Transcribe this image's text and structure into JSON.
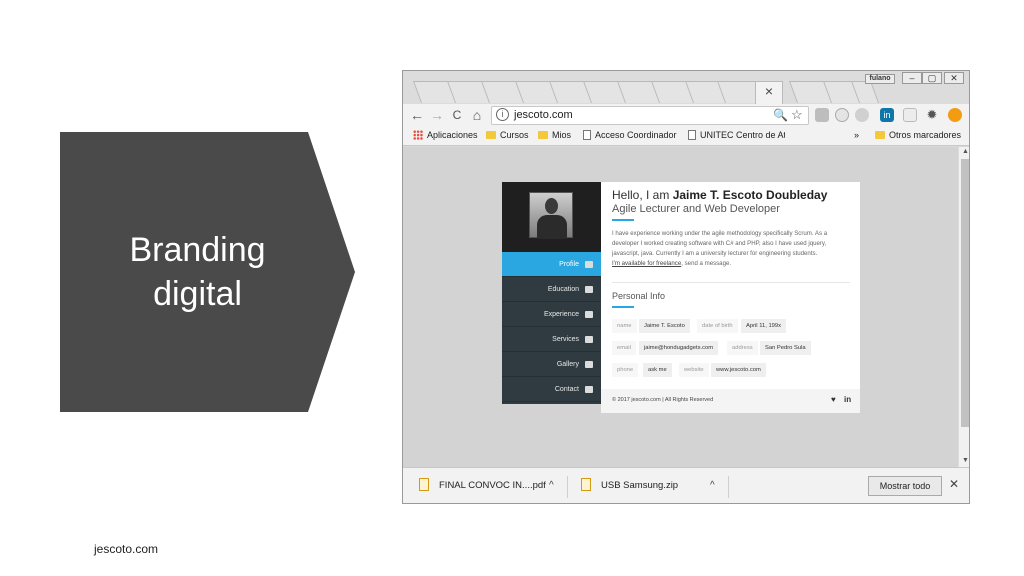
{
  "slide": {
    "title_line1": "Branding",
    "title_line2": "digital",
    "footer": "jescoto.com",
    "shape_color": "#4a4a4a"
  },
  "browser": {
    "tab_close": "×",
    "window_user": "fulano",
    "window_buttons": [
      "–",
      "▢",
      "✕"
    ],
    "toolbar": {
      "back": "←",
      "forward": "→",
      "reload": "C",
      "home": "⌂",
      "url": "jescoto.com",
      "info": "i",
      "zoom": "🔍",
      "star": "☆"
    },
    "bookmarks": {
      "apps": "Aplicaciones",
      "items": [
        "Cursos",
        "Mios",
        "Acceso Coordinador",
        "UNITEC Centro de At"
      ],
      "more": "»",
      "other": "Otros marcadores"
    },
    "downloads": {
      "items": [
        "FINAL CONVOC IN....pdf",
        "USB Samsung.zip"
      ],
      "chevron": "^",
      "show_all": "Mostrar todo",
      "close": "✕"
    }
  },
  "site": {
    "hello_prefix": "Hello, I am ",
    "name": "Jaime T. Escoto Doubleday",
    "subtitle": "Agile Lecturer and Web Developer",
    "bio": "I have experience working under the agile methodology specifically Scrum. As a developer I worked creating software with C# and PHP, also I have used jquery, javascript, java. Currently I am a university lecturer for engineering students.",
    "freelance_link": "I'm available for freelance",
    "freelance_rest": ", send a message.",
    "personal_info_title": "Personal Info",
    "menu": [
      "Profile",
      "Education",
      "Experience",
      "Services",
      "Gallery",
      "Contact"
    ],
    "info": [
      {
        "label": "name",
        "value": "Jaime T. Escoto"
      },
      {
        "label": "date of birth",
        "value": "April 11, 199x"
      },
      {
        "label": "email",
        "value": "jaime@hondugadgets.com"
      },
      {
        "label": "address",
        "value": "San Pedro Sula"
      },
      {
        "label": "phone",
        "value": "ask me"
      },
      {
        "label": "website",
        "value": "www.jescoto.com"
      }
    ],
    "copyright": "© 2017 jescoto.com  |  All Rights Reserved",
    "social": [
      "♥",
      "in"
    ],
    "accent_color": "#2aa7e0"
  }
}
